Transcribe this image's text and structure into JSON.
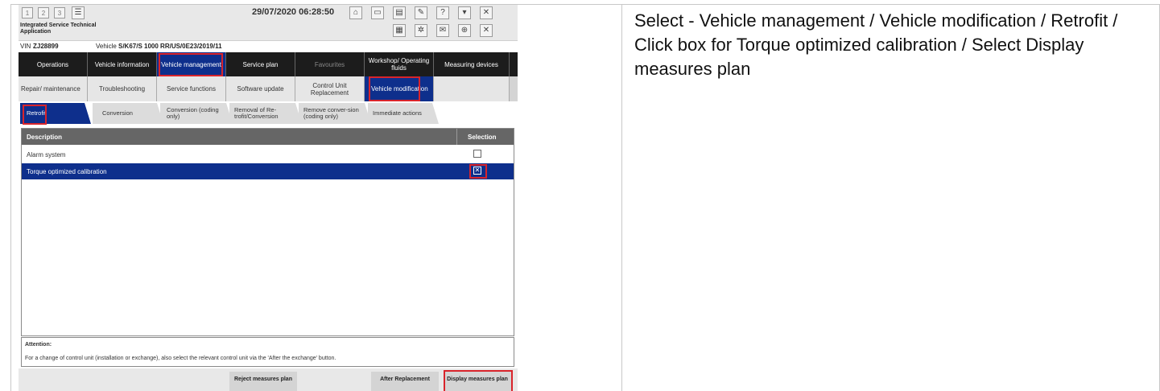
{
  "toolbar": {
    "tab1": "1",
    "tab2": "2",
    "tab3": "3",
    "datetime": "29/07/2020 06:28:50"
  },
  "app": {
    "title_line1": "Integrated Service Technical",
    "title_line2": "Application"
  },
  "vehicle": {
    "vin_label": "VIN",
    "vin": "ZJ28899",
    "vehicle_label": "Vehicle",
    "vehicle": "S/K67/S 1000 RR/US/0E23/2019/11"
  },
  "nav1": [
    "Operations",
    "Vehicle information",
    "Vehicle management",
    "Service plan",
    "Favourites",
    "Workshop/ Operating fluids",
    "Measuring devices"
  ],
  "nav2": [
    "Repair/ maintenance",
    "Troubleshooting",
    "Service functions",
    "Software update",
    "Control Unit Replacement",
    "Vehicle modification"
  ],
  "tabs": [
    "Retrofit",
    "Conversion",
    "Conversion (coding only)",
    "Removal of Re-trofit/Conversion",
    "Remove conver-sion (coding only)",
    "Immediate actions"
  ],
  "table": {
    "col_description": "Description",
    "col_selection": "Selection",
    "rows": [
      {
        "label": "Alarm system",
        "checked": false
      },
      {
        "label": "Torque optimized calibration",
        "checked": true
      }
    ]
  },
  "attention": {
    "heading": "Attention:",
    "body": "For a change of control unit (installation or exchange), also select the relevant control unit via the 'After the exchange' button."
  },
  "buttons": {
    "reject": "Reject measures plan",
    "after": "After Replacement",
    "display": "Display measures plan"
  },
  "instruction": "Select - Vehicle management / Vehicle modification / Retrofit / Click box for Torque optimized calibration / Select Display measures plan",
  "colors": {
    "selected": "#0e2f8c",
    "highlight": "#d9242b"
  }
}
